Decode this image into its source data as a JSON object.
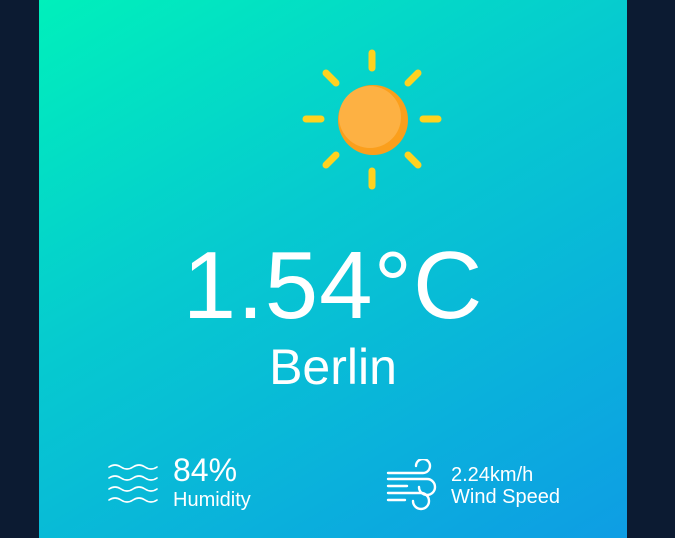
{
  "weather": {
    "icon": "sun-icon",
    "temperature": "1.54°C",
    "city": "Berlin"
  },
  "humidity": {
    "icon": "humidity-waves-icon",
    "value": "84%",
    "label": "Humidity"
  },
  "wind": {
    "icon": "wind-icon",
    "value": "2.24km/h",
    "label": "Wind Speed"
  },
  "colors": {
    "background": "#0c1b32",
    "card_gradient_start": "#00f0bb",
    "card_gradient_end": "#0e9de4",
    "sun_core": "#fdb143",
    "sun_rays": "#ffd21f",
    "text": "#ffffff"
  }
}
